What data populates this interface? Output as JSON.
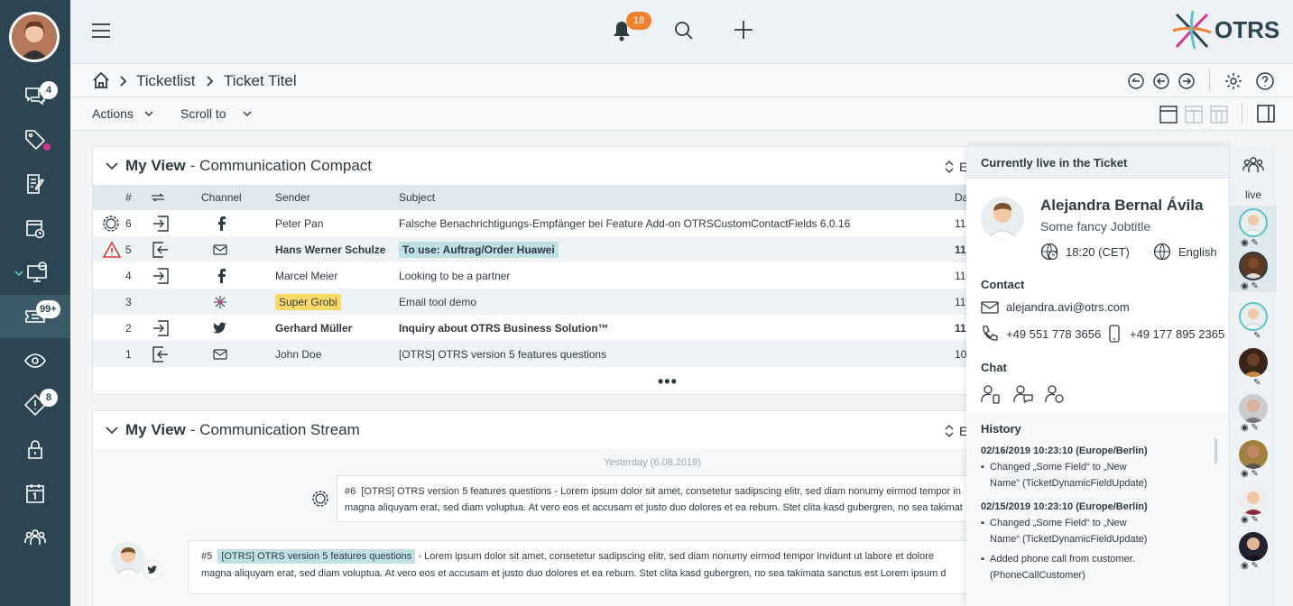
{
  "sidebar": {
    "badges": {
      "chat": "4",
      "tickets": "99+",
      "escalations": "8"
    }
  },
  "topbar": {
    "notification_count": "18",
    "brand": "OTRS"
  },
  "breadcrumb": {
    "items": [
      "Ticketlist",
      "Ticket Titel"
    ]
  },
  "actionbar": {
    "actions_label": "Actions",
    "scroll_label": "Scroll to"
  },
  "compact": {
    "title_bold": "My View",
    "title_sub": "- Communication Compact",
    "expand_label": "E",
    "columns": {
      "num": "#",
      "channel": "Channel",
      "sender": "Sender",
      "subject": "Subject",
      "date": "Da"
    },
    "rows": [
      {
        "num": "6",
        "sender": "Peter Pan",
        "subject": "Falsche Benachrichtigungs-Empfänger bei Feature Add-on OTRSCustomContactFields 6.0.16",
        "date": "11"
      },
      {
        "num": "5",
        "sender": "Hans Werner Schulze",
        "subject": "To use: Auftrag/Order Huawei",
        "date": "11"
      },
      {
        "num": "4",
        "sender": "Marcel Meier",
        "subject": "Looking to be a partner",
        "date": "11"
      },
      {
        "num": "3",
        "sender": "Super Grobi",
        "subject": "Email tool demo",
        "date": "11"
      },
      {
        "num": "2",
        "sender": "Gerhard Müller",
        "subject": "Inquiry about OTRS Business Solution™",
        "date": "11"
      },
      {
        "num": "1",
        "sender": "John Doe",
        "subject": "[OTRS] OTRS version 5 features questions",
        "date": "10"
      }
    ]
  },
  "stream": {
    "title_bold": "My View",
    "title_sub": "- Communication Stream",
    "expand_label": "E",
    "date_label": "Yesterday (6.08.2019)",
    "msg6": {
      "num": "#6",
      "line1": "[OTRS] OTRS version 5 features questions - Lorem ipsum dolor sit amet, consetetur sadipscing elitr, sed diam nonumy eirmod tempor in",
      "line2": "magna aliquyam erat, sed diam voluptua. At vero eos et accusam et justo duo dolores et ea rebum. Stet clita kasd gubergren, no sea takimat"
    },
    "msg5": {
      "num": "#5",
      "subject": "[OTRS] OTRS version 5 features questions",
      "line1": "- Lorem ipsum dolor sit amet, consetetur sadipscing elitr, sed diam nonumy eirmod tempor invidunt ut labore et dolore",
      "line2": "magna aliquyam erat, sed diam voluptua. At vero eos et accusam et justo duo dolores et ea rebum. Stet clita kasd gubergren, no sea takimata sanctus est Lorem ipsum d"
    }
  },
  "live": {
    "header": "Currently live in the Ticket",
    "name": "Alejandra Bernal Ávila",
    "job": "Some fancy Jobtitle",
    "time": "18:20 (CET)",
    "language": "English",
    "contact_title": "Contact",
    "email": "alejandra.avi@otrs.com",
    "phone": "+49 551 778 3656",
    "mobile": "+49 177 895 2365",
    "chat_title": "Chat",
    "history_title": "History",
    "history": [
      {
        "ts": "02/16/2019 10:23:10 (Europe/Berlin)",
        "item1": "Changed „Some Field“ to „New",
        "item2": "Name“ (TicketDynamicFieldUpdate)"
      },
      {
        "ts": "02/15/2019 10:23:10 (Europe/Berlin)",
        "item1": "Changed „Some Field“ to „New",
        "item2": "Name“ (TicketDynamicFieldUpdate)",
        "item3": "Added phone call from customer.",
        "item4": "(PhoneCallCustomer)"
      }
    ],
    "side_label": "live"
  },
  "colors": {
    "sidebar": "#2b4652",
    "accent": "#f0822f",
    "highlight": "#bfe0e4",
    "yellow": "#ffd966"
  }
}
